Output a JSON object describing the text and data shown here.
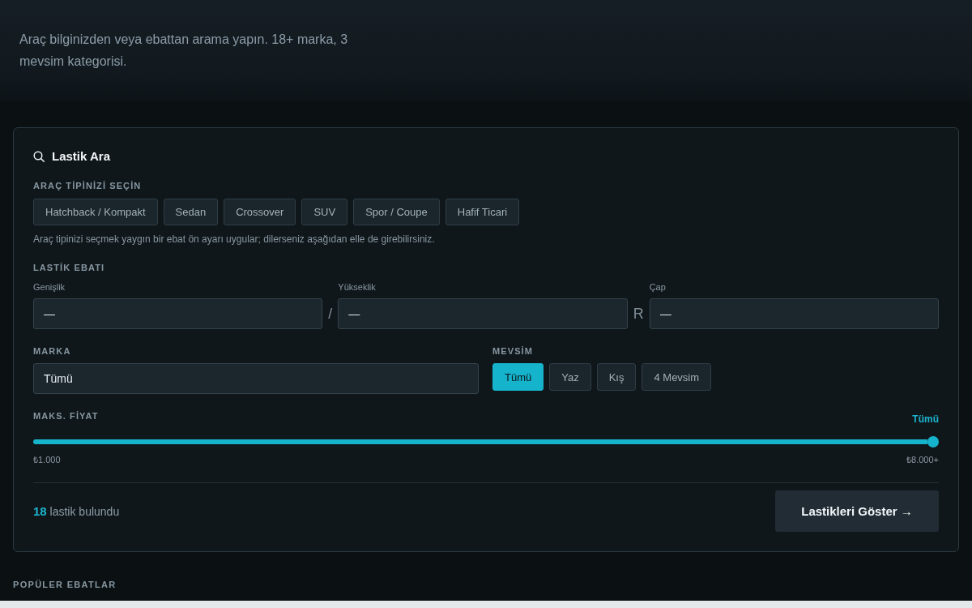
{
  "header": {
    "subtitle": "Araç bilginizden veya ebattan arama yapın. 18+ marka, 3 mevsim kategorisi."
  },
  "search_card": {
    "title": "Lastik Ara",
    "vehicle_type": {
      "label": "ARAÇ TİPİNİZİ SEÇİN",
      "options": [
        {
          "label": "Hatchback / Kompakt",
          "selected": false
        },
        {
          "label": "Sedan",
          "selected": false
        },
        {
          "label": "Crossover",
          "selected": false
        },
        {
          "label": "SUV",
          "selected": false
        },
        {
          "label": "Spor / Coupe",
          "selected": false
        },
        {
          "label": "Hafif Ticari",
          "selected": false
        }
      ],
      "hint": "Araç tipinizi seçmek yaygın bir ebat ön ayarı uygular; dilerseniz aşağıdan elle de girebilirsiniz."
    },
    "tire_size": {
      "label": "LASTİK EBATI",
      "fields": [
        {
          "label": "Genişlik",
          "value": "—"
        },
        {
          "label": "Yükseklik",
          "value": "—"
        },
        {
          "label": "Çap",
          "value": "—"
        }
      ],
      "separators": [
        "/",
        "R"
      ]
    },
    "brand": {
      "label": "MARKA",
      "value": "Tümü"
    },
    "season": {
      "label": "MEVSİM",
      "options": [
        {
          "label": "Tümü",
          "selected": true
        },
        {
          "label": "Yaz",
          "selected": false
        },
        {
          "label": "Kış",
          "selected": false
        },
        {
          "label": "4 Mevsim",
          "selected": false
        }
      ]
    },
    "max_price": {
      "label": "MAKS. FİYAT",
      "reading": "Tümü",
      "level": 1,
      "min_label": "₺1.000",
      "max_label": "₺8.000+"
    },
    "result": {
      "count": "18",
      "text": "lastik bulundu"
    },
    "submit_button": "Lastikleri Göster →"
  },
  "popular_sizes": {
    "heading": "POPÜLER EBATLAR"
  }
}
